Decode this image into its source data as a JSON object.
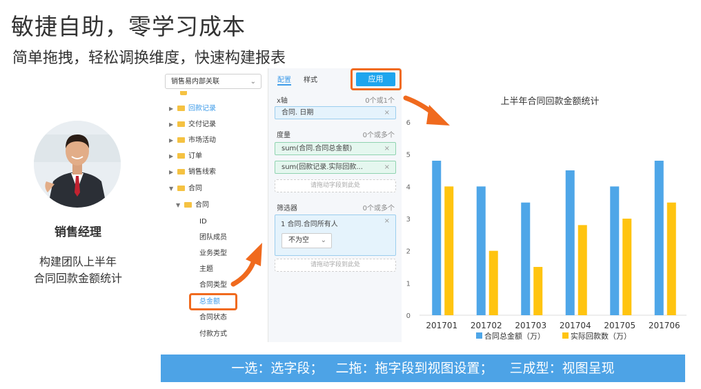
{
  "slide": {
    "title": "敏捷自助，零学习成本",
    "subtitle": "简单拖拽，轻松调换维度，快速构建报表"
  },
  "persona": {
    "role": "销售经理",
    "desc_line1": "构建团队上半年",
    "desc_line2": "合同回款金额统计"
  },
  "left_panel": {
    "datasource": "销售易内部关联",
    "tree": [
      {
        "label": "回款记录",
        "type": "folder",
        "collapsed": true,
        "active": true
      },
      {
        "label": "交付记录",
        "type": "folder",
        "collapsed": true
      },
      {
        "label": "市场活动",
        "type": "folder",
        "collapsed": true
      },
      {
        "label": "订单",
        "type": "folder",
        "collapsed": true
      },
      {
        "label": "销售线索",
        "type": "folder",
        "collapsed": true
      },
      {
        "label": "合同",
        "type": "folder",
        "collapsed": false
      },
      {
        "label": "合同",
        "type": "folder",
        "collapsed": false
      },
      {
        "label": "ID",
        "type": "field"
      },
      {
        "label": "团队成员",
        "type": "field"
      },
      {
        "label": "业务类型",
        "type": "field"
      },
      {
        "label": "主题",
        "type": "field"
      },
      {
        "label": "合同类型",
        "type": "field"
      },
      {
        "label": "总金额",
        "type": "field",
        "active": true
      },
      {
        "label": "合同状态",
        "type": "field"
      },
      {
        "label": "付款方式",
        "type": "field"
      }
    ]
  },
  "config": {
    "tab_config": "配置",
    "tab_style": "样式",
    "apply": "应用",
    "xaxis_label": "x轴",
    "xaxis_hint": "0个或1个",
    "xaxis_field": "合同. 日期",
    "measure_label": "度量",
    "measure_hint": "0个或多个",
    "measure_fields": [
      "sum(合同.合同总金额)",
      "sum(回款记录.实际回款..."
    ],
    "drop_hint": "请拖动字段到此处",
    "filter_label": "筛选器",
    "filter_hint": "0个或多个",
    "filter_field": "1 合同.合同所有人",
    "filter_value": "不为空",
    "close": "×",
    "chevron": "⌄"
  },
  "banner": {
    "text": "一选：选字段；   二拖：拖字段到视图设置；    三成型：视图呈现"
  },
  "colors": {
    "series1": "#4ea6e8",
    "series2": "#ffc410",
    "accent": "#f06a1e",
    "banner": "#4da3e6"
  },
  "chart_data": {
    "type": "bar",
    "title": "上半年合同回款金额统计",
    "categories": [
      "201701",
      "201702",
      "201703",
      "201704",
      "201705",
      "201706"
    ],
    "series": [
      {
        "name": "合同总金额（万）",
        "values": [
          4.8,
          4.0,
          3.5,
          4.5,
          4.0,
          4.8
        ]
      },
      {
        "name": "实际回款数（万）",
        "values": [
          4.0,
          2.0,
          1.5,
          2.8,
          3.0,
          3.5
        ]
      }
    ],
    "yticks": [
      "0",
      "1",
      "2",
      "3",
      "4",
      "5",
      "6"
    ],
    "ylim": [
      0,
      6
    ],
    "grid": false,
    "legend": "bottom"
  }
}
